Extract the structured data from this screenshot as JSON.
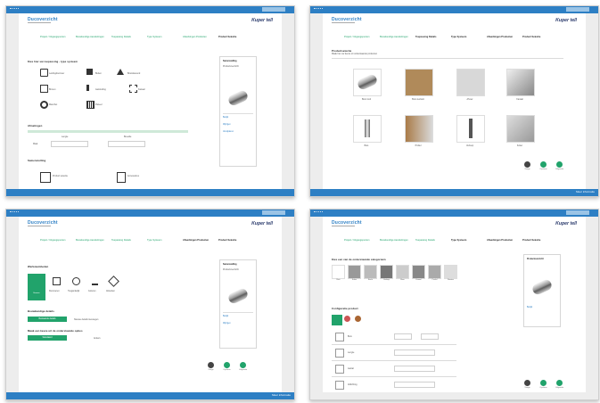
{
  "colors": {
    "accent_blue": "#2d7fc4",
    "accent_green": "#21a36b",
    "brand_navy": "#2a3a6c"
  },
  "app": {
    "logo": "Ducoverzicht",
    "brand": "Kuper tell"
  },
  "nav_items": [
    {
      "label": "Project / Uitgangspunten",
      "active": false
    },
    {
      "label": "Bouwkundige Aansluitingen",
      "active": false
    },
    {
      "label": "Toepassing Details",
      "active": false
    },
    {
      "label": "Type Systeem",
      "active": false
    },
    {
      "label": "Afwerkingen Producten",
      "active": false
    },
    {
      "label": "Product Selectie",
      "active": true
    }
  ],
  "footer": {
    "link": "Meer informatie",
    "text": "Kuper tell"
  },
  "panel1": {
    "section_title": "Kies hier uw toepassing - type systeem",
    "options": [
      {
        "icon": "pipe-icon",
        "label": "Leidingdoorvoer"
      },
      {
        "icon": "building-icon",
        "label": "Buiten"
      },
      {
        "icon": "alert-icon",
        "label": "Brandwerend"
      },
      {
        "icon": "wall-icon",
        "label": "Binnen"
      },
      {
        "icon": "pipe-end-icon",
        "label": "Aansluiting"
      },
      {
        "icon": "grid-icon",
        "label": "Kanaal"
      },
      {
        "icon": "ring-icon",
        "label": "Manchet"
      },
      {
        "icon": "panel-icon",
        "label": "Paneel"
      }
    ],
    "dimensions_title": "Afmetingen",
    "dim_labels": [
      "Lengte",
      "Breedte"
    ],
    "dim_row_label": "Maat",
    "selection_title": "Samenstelling",
    "selection_items": [
      "Product selectie",
      "Accessoires"
    ]
  },
  "panel2": {
    "section_title": "Productselectie",
    "subtitle": "Maak hier uw keuze uit onderstaande producten",
    "products": [
      "Buis rond",
      "Buis vierkant",
      "Afvoer",
      "Kanaal",
      "Buis",
      "Profiel",
      "Verloop",
      "Koker"
    ],
    "actions": [
      "Vorige",
      "Opslaan",
      "Volgende"
    ]
  },
  "panel3": {
    "section_title": "Werkzaamheden",
    "items": [
      "Bouwen",
      "Renoveren",
      "Toegankelijk",
      "Isoleren",
      "Afwerken"
    ],
    "group1_title": "Bouwkundige details",
    "group1_button": "Bestaande details",
    "group1_text": "Nieuwe details toevoegen",
    "group2_title": "Maak een keuze uit de onderstaande opties",
    "group2_button": "Standaard",
    "group2_text": "Anders",
    "actions": [
      "Vorige",
      "Opslaan",
      "Volgende"
    ]
  },
  "panel4": {
    "section_title": "Kies een van de onderstaande categorieën",
    "categories": [
      "Buis",
      "Koker",
      "Bocht",
      "Verloop",
      "Muur",
      "Kanaal",
      "Profiel",
      "Rooster"
    ],
    "config_title": "Configuratie product",
    "config_rows": [
      "Buis",
      "Lengte",
      "Aantal",
      "Afdichting"
    ],
    "side_title": "Productoverzicht",
    "actions": [
      "Vorige",
      "Opslaan",
      "Volgende"
    ]
  },
  "sidebar": {
    "title": "Samenstelling",
    "subtitle": "Productoverzicht",
    "items": [
      "Bekijk",
      "Wijzigen",
      "Verwijderen"
    ]
  }
}
